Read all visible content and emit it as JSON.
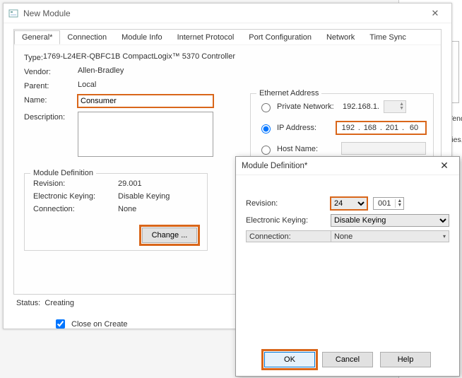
{
  "main": {
    "title": "New Module",
    "tabs": [
      "General*",
      "Connection",
      "Module Info",
      "Internet Protocol",
      "Port Configuration",
      "Network",
      "Time Sync"
    ],
    "type_label": "Type:",
    "type_value": "1769-L24ER-QBFC1B CompactLogix™ 5370 Controller",
    "vendor_label": "Vendor:",
    "vendor_value": "Allen-Bradley",
    "parent_label": "Parent:",
    "parent_value": "Local",
    "name_label": "Name:",
    "name_value": "Consumer",
    "desc_label": "Description:",
    "eth_legend": "Ethernet Address",
    "private_label": "Private Network:",
    "private_prefix": "192.168.1.",
    "ip_label": "IP Address:",
    "ip_octets": [
      "192",
      "168",
      "201",
      "60"
    ],
    "host_label": "Host Name:",
    "moddef_legend": "Module Definition",
    "revision_k": "Revision:",
    "revision_v": "29.001",
    "ek_k": "Electronic Keying:",
    "ek_v": "Disable Keying",
    "conn_k": "Connection:",
    "conn_v": "None",
    "change_btn": "Change ...",
    "status_label": "Status:",
    "status_value": "Creating",
    "close_on_create": "Close on Create"
  },
  "backdrop": {
    "line1": "Module Type Vendor Filters",
    "line2": "Energy Industries, Inc."
  },
  "sub": {
    "title": "Module Definition*",
    "revision_label": "Revision:",
    "revision_major": "24",
    "revision_minor": "001",
    "ek_label": "Electronic Keying:",
    "ek_value": "Disable Keying",
    "conn_label": "Connection:",
    "conn_value": "None",
    "ok": "OK",
    "cancel": "Cancel",
    "help": "Help"
  }
}
